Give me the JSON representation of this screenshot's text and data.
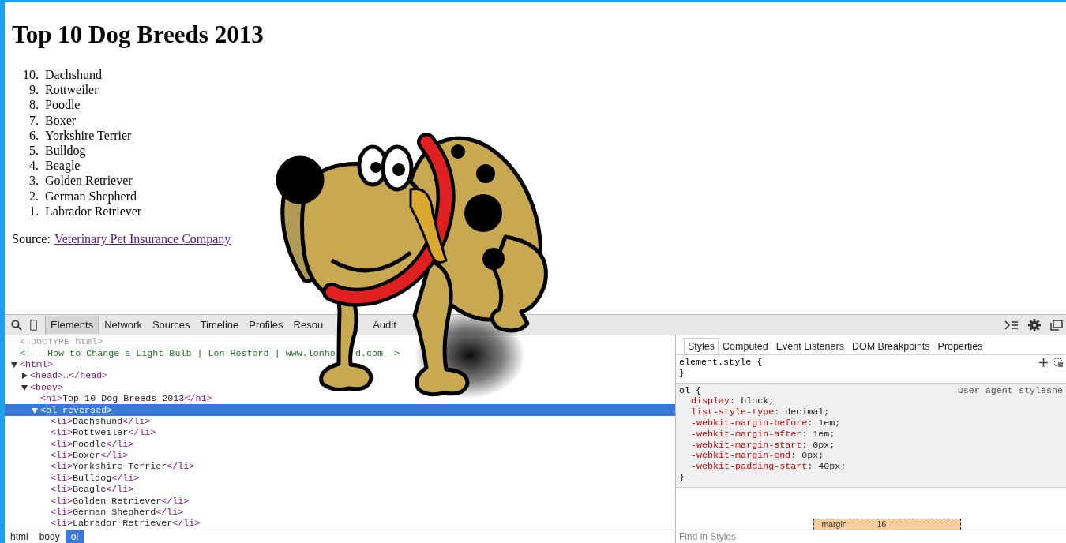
{
  "page": {
    "heading": "Top 10 Dog Breeds 2013",
    "list": [
      {
        "number": "10.",
        "text": "Dachshund"
      },
      {
        "number": "9.",
        "text": "Rottweiler"
      },
      {
        "number": "8.",
        "text": "Poodle"
      },
      {
        "number": "7.",
        "text": "Boxer"
      },
      {
        "number": "6.",
        "text": "Yorkshire Terrier"
      },
      {
        "number": "5.",
        "text": "Bulldog"
      },
      {
        "number": "4.",
        "text": "Beagle"
      },
      {
        "number": "3.",
        "text": "Golden Retriever"
      },
      {
        "number": "2.",
        "text": "German Shepherd"
      },
      {
        "number": "1.",
        "text": "Labrador Retriever"
      }
    ],
    "source_label": "Source:",
    "source_link": "Veterinary Pet Insurance Company"
  },
  "devtools": {
    "tabs": [
      {
        "label": "Elements",
        "selected": true
      },
      {
        "label": "Network",
        "selected": false
      },
      {
        "label": "Sources",
        "selected": false
      },
      {
        "label": "Timeline",
        "selected": false
      },
      {
        "label": "Profiles",
        "selected": false
      },
      {
        "label": "Resou",
        "selected": false
      },
      {
        "label": "Audit",
        "selected": false
      }
    ],
    "dom_tree": [
      {
        "selected": false,
        "tokens": [
          {
            "kind": "doctype",
            "text": "<!DOCTYPE html>"
          }
        ]
      },
      {
        "selected": false,
        "tokens": [
          {
            "kind": "comment",
            "text": "<!-- How to Change a Light Bulb | Lon Hosford | www.lonho"
          },
          {
            "kind": "comment-tail",
            "text": "d.com-->"
          }
        ]
      },
      {
        "selected": false,
        "expanded": true,
        "tokens": [
          {
            "kind": "tag",
            "text": "<html>"
          }
        ],
        "children": [
          {
            "selected": false,
            "expanded": false,
            "tokens": [
              {
                "kind": "tag",
                "text": "<head>"
              },
              {
                "kind": "text",
                "text": "…"
              },
              {
                "kind": "tag",
                "text": "</head>"
              }
            ]
          },
          {
            "selected": false,
            "expanded": true,
            "tokens": [
              {
                "kind": "tag",
                "text": "<body>"
              }
            ],
            "children": [
              {
                "selected": false,
                "tokens": [
                  {
                    "kind": "tag",
                    "text": "<h1>"
                  },
                  {
                    "kind": "text",
                    "text": "Top 10 Dog Breeds 2013"
                  },
                  {
                    "kind": "tag",
                    "text": "</h1>"
                  }
                ]
              },
              {
                "selected": true,
                "expanded": true,
                "tokens": [
                  {
                    "kind": "tag",
                    "text": "<ol"
                  },
                  {
                    "kind": "attr",
                    "text": "reversed"
                  },
                  {
                    "kind": "tag",
                    "text": ">"
                  }
                ],
                "children": [
                  {
                    "selected": false,
                    "tokens": [
                      {
                        "kind": "tag",
                        "text": "<li>"
                      },
                      {
                        "kind": "text",
                        "text": "Dachshund"
                      },
                      {
                        "kind": "tag",
                        "text": "</li>"
                      }
                    ]
                  },
                  {
                    "selected": false,
                    "tokens": [
                      {
                        "kind": "tag",
                        "text": "<li>"
                      },
                      {
                        "kind": "text",
                        "text": "Rottweiler"
                      },
                      {
                        "kind": "tag",
                        "text": "</li>"
                      }
                    ]
                  },
                  {
                    "selected": false,
                    "tokens": [
                      {
                        "kind": "tag",
                        "text": "<li>"
                      },
                      {
                        "kind": "text",
                        "text": "Poodle"
                      },
                      {
                        "kind": "tag",
                        "text": "</li>"
                      }
                    ]
                  },
                  {
                    "selected": false,
                    "tokens": [
                      {
                        "kind": "tag",
                        "text": "<li>"
                      },
                      {
                        "kind": "text",
                        "text": "Boxer"
                      },
                      {
                        "kind": "tag",
                        "text": "</li>"
                      }
                    ]
                  },
                  {
                    "selected": false,
                    "tokens": [
                      {
                        "kind": "tag",
                        "text": "<li>"
                      },
                      {
                        "kind": "text",
                        "text": "Yorkshire Terrier"
                      },
                      {
                        "kind": "tag",
                        "text": "</li>"
                      }
                    ]
                  },
                  {
                    "selected": false,
                    "tokens": [
                      {
                        "kind": "tag",
                        "text": "<li>"
                      },
                      {
                        "kind": "text",
                        "text": "Bulldog"
                      },
                      {
                        "kind": "tag",
                        "text": "</li>"
                      }
                    ]
                  },
                  {
                    "selected": false,
                    "tokens": [
                      {
                        "kind": "tag",
                        "text": "<li>"
                      },
                      {
                        "kind": "text",
                        "text": "Beagle"
                      },
                      {
                        "kind": "tag",
                        "text": "</li>"
                      }
                    ]
                  },
                  {
                    "selected": false,
                    "tokens": [
                      {
                        "kind": "tag",
                        "text": "<li>"
                      },
                      {
                        "kind": "text",
                        "text": "Golden Retriever"
                      },
                      {
                        "kind": "tag",
                        "text": "</li>"
                      }
                    ]
                  },
                  {
                    "selected": false,
                    "tokens": [
                      {
                        "kind": "tag",
                        "text": "<li>"
                      },
                      {
                        "kind": "text",
                        "text": "German Shepherd"
                      },
                      {
                        "kind": "tag",
                        "text": "</li>"
                      }
                    ]
                  },
                  {
                    "selected": false,
                    "tokens": [
                      {
                        "kind": "tag",
                        "text": "<li>"
                      },
                      {
                        "kind": "text",
                        "text": "Labrador Retriever"
                      },
                      {
                        "kind": "tag",
                        "text": "</li>"
                      }
                    ]
                  }
                ]
              }
            ]
          }
        ]
      }
    ],
    "breadcrumbs": [
      {
        "label": "html",
        "selected": false
      },
      {
        "label": "body",
        "selected": false
      },
      {
        "label": "ol",
        "selected": true
      }
    ],
    "sidebar_tabs": [
      {
        "label": "Styles",
        "selected": true
      },
      {
        "label": "Computed",
        "selected": false
      },
      {
        "label": "Event Listeners",
        "selected": false
      },
      {
        "label": "DOM Breakpoints",
        "selected": false
      },
      {
        "label": "Properties",
        "selected": false
      }
    ],
    "rules": [
      {
        "selector": "element.style {",
        "closing": "}"
      },
      {
        "selector": "ol {",
        "source": "user agent styleshe",
        "closing": "}",
        "properties": [
          [
            {
              "kind": "prop",
              "text": "display"
            },
            {
              "kind": "plain",
              "text": ": block;"
            }
          ],
          [
            {
              "kind": "prop",
              "text": "list-style-type"
            },
            {
              "kind": "plain",
              "text": ": decimal;"
            }
          ],
          [
            {
              "kind": "prop",
              "text": "-webkit-margin-before"
            },
            {
              "kind": "plain",
              "text": ": 1em;"
            }
          ],
          [
            {
              "kind": "prop",
              "text": "-webkit-margin-after"
            },
            {
              "kind": "plain",
              "text": ": 1em;"
            }
          ],
          [
            {
              "kind": "prop",
              "text": "-webkit-margin-start"
            },
            {
              "kind": "plain",
              "text": ": 0px;"
            }
          ],
          [
            {
              "kind": "prop",
              "text": "-webkit-margin-end"
            },
            {
              "kind": "plain",
              "text": ": 0px;"
            }
          ],
          [
            {
              "kind": "prop",
              "text": "-webkit-padding-start"
            },
            {
              "kind": "plain",
              "text": ": 40px;"
            }
          ]
        ]
      }
    ],
    "box_model": {
      "label": "margin",
      "value": "16"
    },
    "find_field": {
      "placeholder": "Find in Styles"
    }
  }
}
